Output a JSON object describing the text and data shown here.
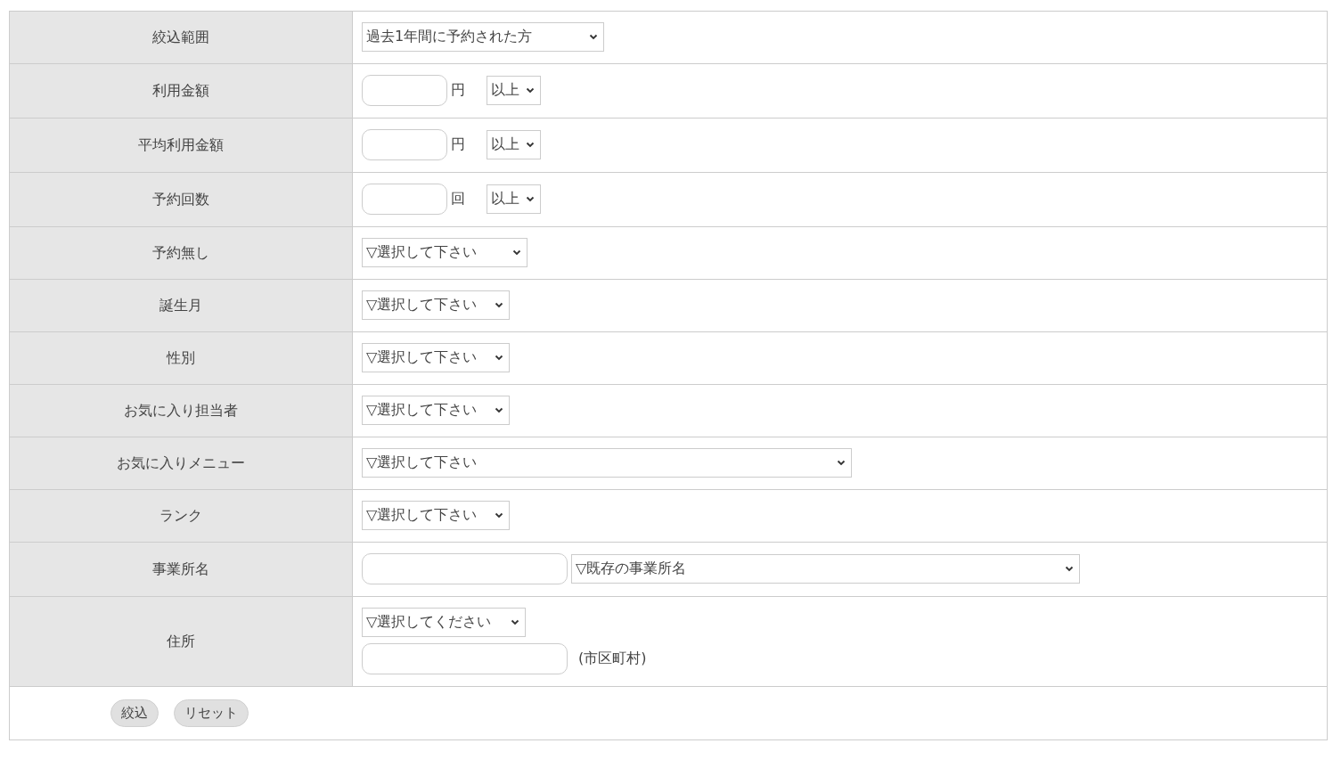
{
  "rows": [
    {
      "label": "絞込範囲",
      "kind": "range",
      "select": "過去1年間に予約された方"
    },
    {
      "label": "利用金額",
      "kind": "amount",
      "unit": "円",
      "select": "以上"
    },
    {
      "label": "平均利用金額",
      "kind": "amount",
      "unit": "円",
      "select": "以上"
    },
    {
      "label": "予約回数",
      "kind": "amount",
      "unit": "回",
      "select": "以上"
    },
    {
      "label": "予約無し",
      "kind": "select-medium",
      "select": "▽選択して下さい"
    },
    {
      "label": "誕生月",
      "kind": "select",
      "select": "▽選択して下さい"
    },
    {
      "label": "性別",
      "kind": "select",
      "select": "▽選択して下さい"
    },
    {
      "label": "お気に入り担当者",
      "kind": "select",
      "select": "▽選択して下さい"
    },
    {
      "label": "お気に入りメニュー",
      "kind": "select-wide",
      "select": "▽選択して下さい"
    },
    {
      "label": "ランク",
      "kind": "select",
      "select": "▽選択して下さい"
    },
    {
      "label": "事業所名",
      "kind": "office",
      "select": "▽既存の事業所名"
    },
    {
      "label": "住所",
      "kind": "address",
      "select": "▽選択してください",
      "note": "(市区町村)"
    }
  ],
  "buttons": [
    "絞込",
    "リセット"
  ]
}
